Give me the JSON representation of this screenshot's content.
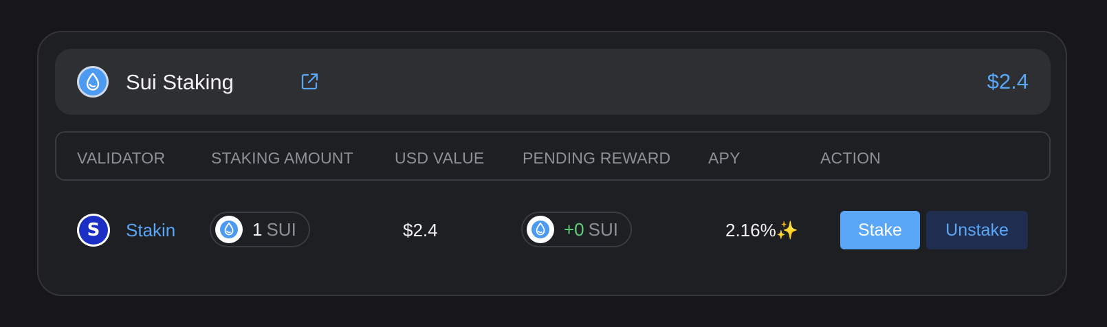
{
  "header": {
    "title": "Sui Staking",
    "total_value": "$2.4",
    "logo_icon": "sui-drop-icon",
    "external_link_icon": "external-link-icon"
  },
  "table": {
    "columns": [
      "VALIDATOR",
      "STAKING AMOUNT",
      "USD VALUE",
      "PENDING REWARD",
      "APY",
      "ACTION"
    ],
    "rows": [
      {
        "validator": "Stakin",
        "validator_logo_letter": "S",
        "staking_amount": "1",
        "staking_unit": "SUI",
        "usd_value": "$2.4",
        "pending_reward": "+0",
        "pending_unit": "SUI",
        "apy": "2.16%✨",
        "stake_label": "Stake",
        "unstake_label": "Unstake"
      }
    ]
  },
  "colors": {
    "accent": "#5aa6f7",
    "positive": "#5ecf7b",
    "background": "#17171a",
    "card": "#1e1f22"
  }
}
